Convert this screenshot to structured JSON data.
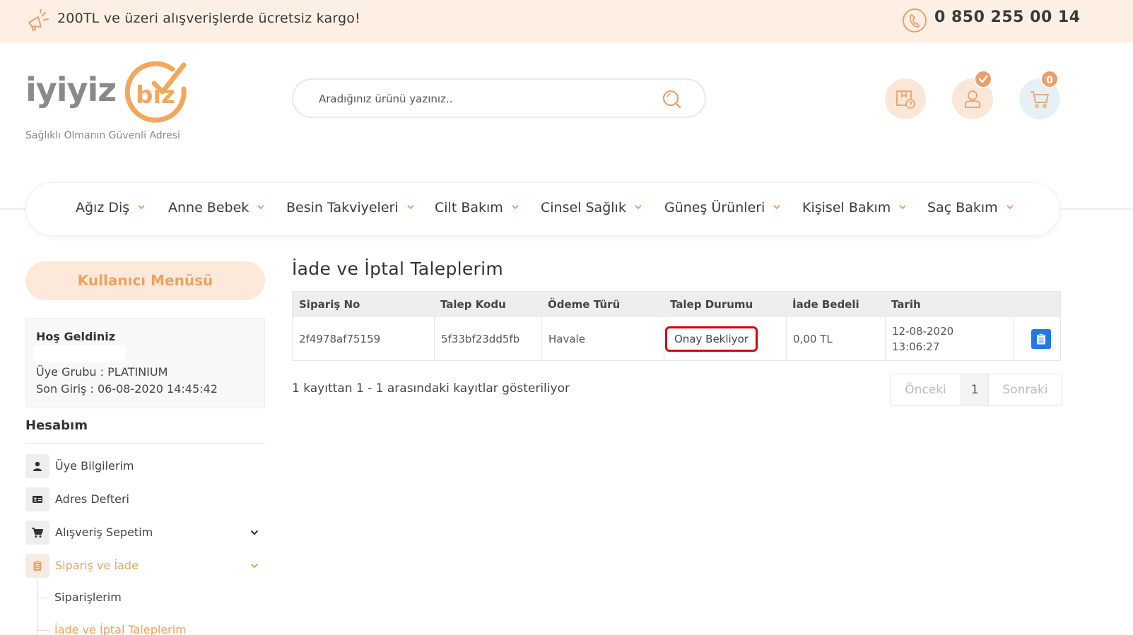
{
  "topbar": {
    "promo": "200TL ve üzeri alışverişlerde ücretsiz kargo!",
    "phone": "0 850 255 00 14"
  },
  "logo": {
    "word": "iyiyiz",
    "circle_word": "biz",
    "tagline": "Sağlıklı Olmanın Güvenli Adresi"
  },
  "search": {
    "placeholder": "Aradığınız ürünü yazınız.."
  },
  "header_icons": {
    "cart_count": "0",
    "accent": "#e9a06c"
  },
  "nav": {
    "items": [
      "Ağız Diş",
      "Anne Bebek",
      "Besin Takviyeleri",
      "Cilt Bakım",
      "Cinsel Sağlık",
      "Güneş Ürünleri",
      "Kişisel Bakım",
      "Saç Bakım"
    ]
  },
  "sidebar": {
    "title": "Kullanıcı Menüsü",
    "welcome": "Hoş Geldiniz",
    "group": "Üye Grubu : PLATINIUM",
    "last_login": "Son Giriş : 06-08-2020 14:45:42",
    "account_title": "Hesabım",
    "items": [
      {
        "label": "Üye Bilgilerim",
        "icon": "user-icon"
      },
      {
        "label": "Adres Defteri",
        "icon": "address-card-icon"
      },
      {
        "label": "Alışveriş Sepetim",
        "icon": "cart-icon"
      },
      {
        "label": "Sipariş ve İade",
        "icon": "clipboard-icon"
      }
    ],
    "sub_items": [
      "Siparişlerim",
      "İade ve İptal Taleplerim"
    ]
  },
  "main": {
    "title": "İade ve İptal Taleplerim",
    "columns": [
      "Sipariş No",
      "Talep Kodu",
      "Ödeme Türü",
      "Talep Durumu",
      "İade Bedeli",
      "Tarih"
    ],
    "rows": [
      {
        "order_no": "2f4978af75159",
        "request_code": "5f33bf23dd5fb",
        "payment": "Havale",
        "status": "Onay Bekliyor",
        "refund": "0,00 TL",
        "date": "12-08-2020",
        "time": "13:06:27"
      }
    ],
    "info": "1 kayıttan 1 - 1 arasındaki kayıtlar gösteriliyor",
    "pager": {
      "prev": "Önceki",
      "page": "1",
      "next": "Sonraki"
    }
  }
}
